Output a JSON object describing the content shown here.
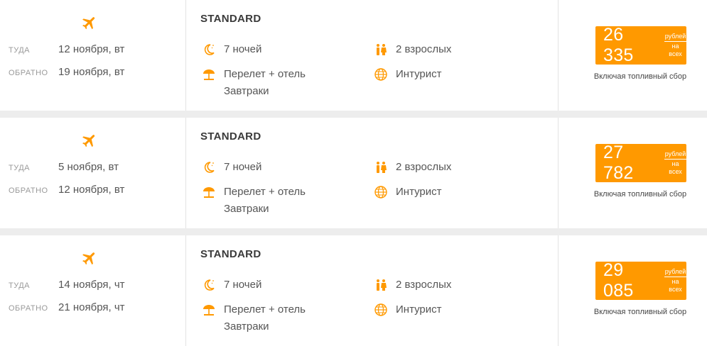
{
  "accent_color": "#ff9900",
  "offers": [
    {
      "departure_label": "ТУДА",
      "departure_date": "12 ноября, вт",
      "return_label": "ОБРАТНО",
      "return_date": "19 ноября, вт",
      "tariff": "STANDARD",
      "nights": "7 ночей",
      "travelers": "2 взрослых",
      "package_line1": "Перелет + отель",
      "package_line2": "Завтраки",
      "operator": "Интурист",
      "price": "26 335",
      "price_unit_top": "рублей",
      "price_unit_bottom": "на всех",
      "price_note": "Включая топливный сбор"
    },
    {
      "departure_label": "ТУДА",
      "departure_date": "5 ноября, вт",
      "return_label": "ОБРАТНО",
      "return_date": "12 ноября, вт",
      "tariff": "STANDARD",
      "nights": "7 ночей",
      "travelers": "2 взрослых",
      "package_line1": "Перелет + отель",
      "package_line2": "Завтраки",
      "operator": "Интурист",
      "price": "27 782",
      "price_unit_top": "рублей",
      "price_unit_bottom": "на всех",
      "price_note": "Включая топливный сбор"
    },
    {
      "departure_label": "ТУДА",
      "departure_date": "14 ноября, чт",
      "return_label": "ОБРАТНО",
      "return_date": "21 ноября, чт",
      "tariff": "STANDARD",
      "nights": "7 ночей",
      "travelers": "2 взрослых",
      "package_line1": "Перелет + отель",
      "package_line2": "Завтраки",
      "operator": "Интурист",
      "price": "29 085",
      "price_unit_top": "рублей",
      "price_unit_bottom": "на всех",
      "price_note": "Включая топливный сбор"
    }
  ],
  "icons": {
    "flight": "airplane-icon",
    "nights": "moon-icon",
    "package": "beach-umbrella-icon",
    "travelers": "people-icon",
    "operator": "globe-icon"
  }
}
